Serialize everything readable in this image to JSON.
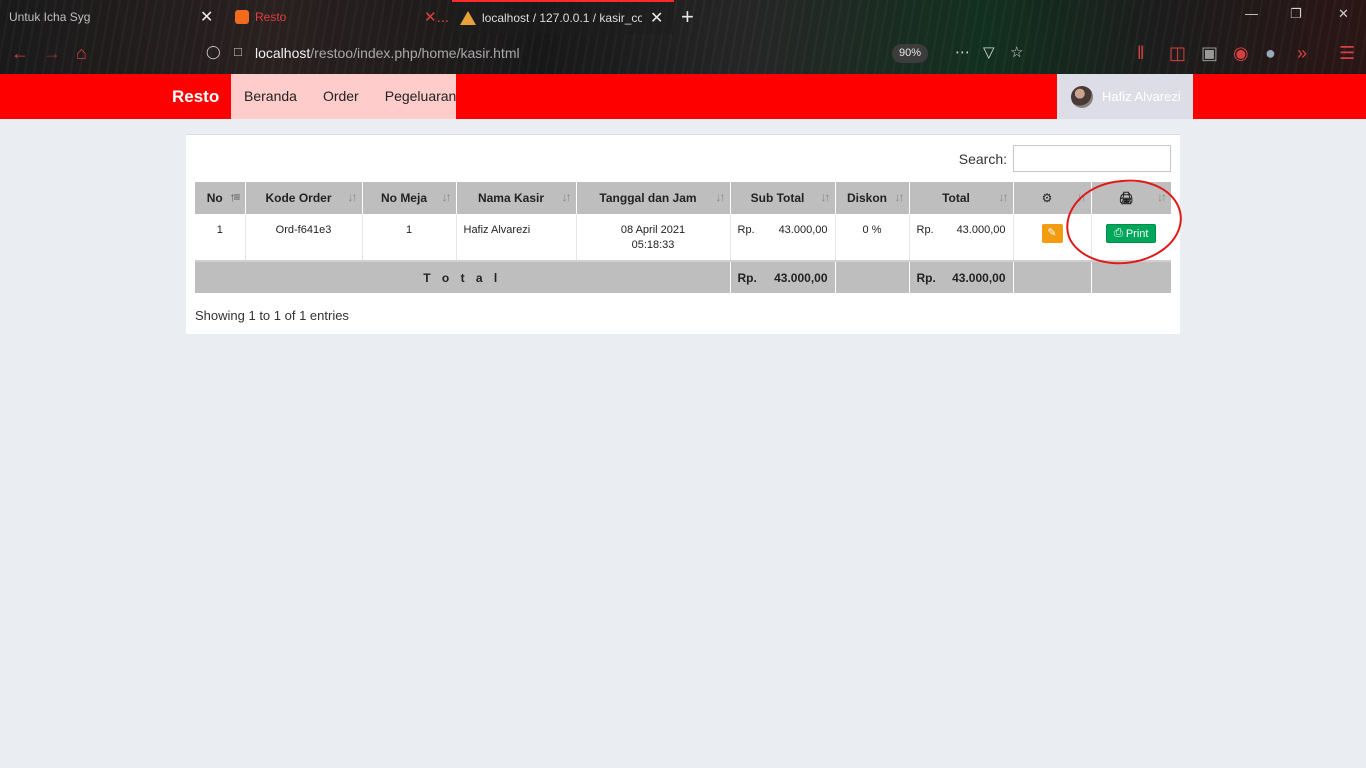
{
  "browser": {
    "tabs": [
      {
        "title": "Untuk Icha Syg",
        "close": "✕"
      },
      {
        "title": "Resto",
        "close": "✕..."
      },
      {
        "title": "localhost / 127.0.0.1 / kasir_cof",
        "close": "✕"
      }
    ],
    "new_tab": "+",
    "url_host": "localhost",
    "url_path": "/restoo/index.php/home/kasir.html",
    "zoom": "90%",
    "window_controls": [
      "minimize-icon",
      "restore-icon",
      "close-icon"
    ]
  },
  "app": {
    "brand": "Resto",
    "menu": [
      "Beranda",
      "Order",
      "Pegeluaran"
    ],
    "user_name": "Hafiz Alvarezi",
    "accent_color": "#ff0000"
  },
  "table": {
    "search_label": "Search:",
    "headers": [
      "No",
      "Kode Order",
      "No Meja",
      "Nama Kasir",
      "Tanggal dan Jam",
      "Sub Total",
      "Diskon",
      "Total",
      "⚙",
      "🖨"
    ],
    "rows": [
      {
        "no": "1",
        "kode_order": "Ord-f641e3",
        "no_meja": "1",
        "nama_kasir": "Hafiz Alvarezi",
        "tanggal": "08 April 2021",
        "jam": "05:18:33",
        "sub_total_cur": "Rp.",
        "sub_total": "43.000,00",
        "diskon": "0 %",
        "total_cur": "Rp.",
        "total": "43.000,00",
        "print_label": "Print"
      }
    ],
    "footer": {
      "label": "T o t a l",
      "sub_total_cur": "Rp.",
      "sub_total": "43.000,00",
      "total_cur": "Rp.",
      "total": "43.000,00"
    },
    "info": "Showing 1 to 1 of 1 entries"
  }
}
